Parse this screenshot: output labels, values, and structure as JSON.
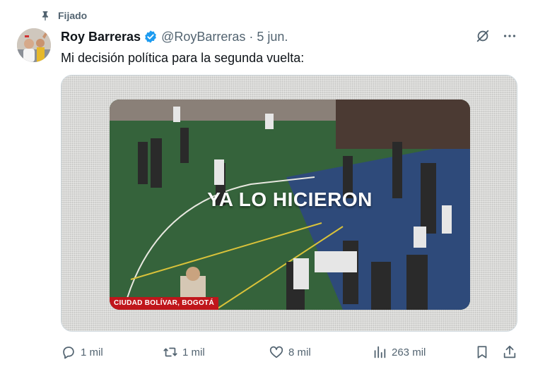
{
  "pinned_label": "Fijado",
  "tweet": {
    "author_name": "Roy Barreras",
    "handle": "@RoyBarreras",
    "separator": "·",
    "time": "5 jun.",
    "text": "Mi decisión política para la segunda vuelta:",
    "media": {
      "overlay_text": "YA LO HICIERON",
      "location_caption": "CIUDAD BOLÍVAR, BOGOTÁ"
    },
    "stats": {
      "replies": "1 mil",
      "retweets": "1 mil",
      "likes": "8 mil",
      "views": "263 mil"
    }
  },
  "colors": {
    "text_secondary": "#536471",
    "verified_blue": "#1d9bf0",
    "location_red": "#c0161b",
    "court_green": "#35633b",
    "court_blue": "#2e4a7a"
  },
  "icons": [
    "pin-icon",
    "verified-badge-icon",
    "grok-icon",
    "more-icon",
    "reply-icon",
    "retweet-icon",
    "like-icon",
    "views-icon",
    "bookmark-icon",
    "share-icon"
  ]
}
